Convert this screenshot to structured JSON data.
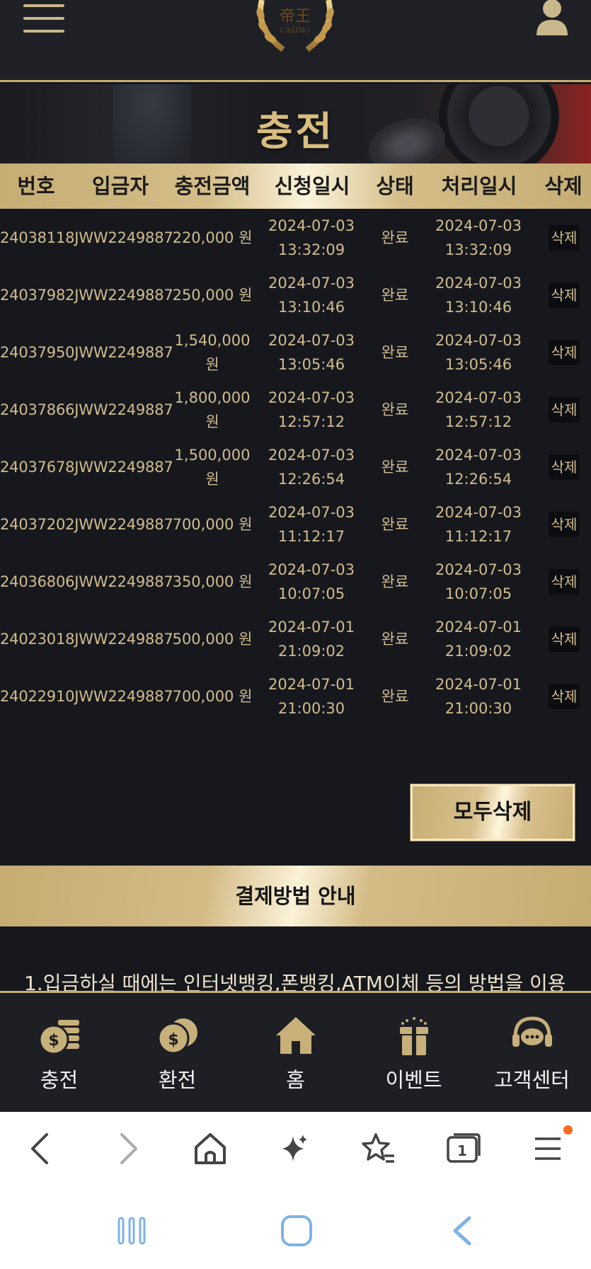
{
  "header": {
    "menu_icon": "hamburger-icon",
    "logo_text": "CASINO",
    "logo_chars": "帝王",
    "user_icon": "user-icon"
  },
  "banner": {
    "title": "충전"
  },
  "table": {
    "columns": [
      "번호",
      "입금자",
      "충전금액",
      "신청일시",
      "상태",
      "처리일시",
      "삭제"
    ],
    "rows": [
      {
        "id": "24038118JWW2249887",
        "amount": "220,000 원",
        "requested": "2024-07-03 13:32:09",
        "status": "완료",
        "processed": "2024-07-03 13:32:09",
        "delete": "삭제"
      },
      {
        "id": "24037982JWW2249887",
        "amount": "250,000 원",
        "requested": "2024-07-03 13:10:46",
        "status": "완료",
        "processed": "2024-07-03 13:10:46",
        "delete": "삭제"
      },
      {
        "id": "24037950JWW2249887",
        "amount": "1,540,000 원",
        "requested": "2024-07-03 13:05:46",
        "status": "완료",
        "processed": "2024-07-03 13:05:46",
        "delete": "삭제"
      },
      {
        "id": "24037866JWW2249887",
        "amount": "1,800,000 원",
        "requested": "2024-07-03 12:57:12",
        "status": "완료",
        "processed": "2024-07-03 12:57:12",
        "delete": "삭제"
      },
      {
        "id": "24037678JWW2249887",
        "amount": "1,500,000 원",
        "requested": "2024-07-03 12:26:54",
        "status": "완료",
        "processed": "2024-07-03 12:26:54",
        "delete": "삭제"
      },
      {
        "id": "24037202JWW2249887",
        "amount": "700,000 원",
        "requested": "2024-07-03 11:12:17",
        "status": "완료",
        "processed": "2024-07-03 11:12:17",
        "delete": "삭제"
      },
      {
        "id": "24036806JWW2249887",
        "amount": "350,000 원",
        "requested": "2024-07-03 10:07:05",
        "status": "완료",
        "processed": "2024-07-03 10:07:05",
        "delete": "삭제"
      },
      {
        "id": "24023018JWW2249887",
        "amount": "500,000 원",
        "requested": "2024-07-01 21:09:02",
        "status": "완료",
        "processed": "2024-07-01 21:09:02",
        "delete": "삭제"
      },
      {
        "id": "24022910JWW2249887",
        "amount": "700,000 원",
        "requested": "2024-07-01 21:00:30",
        "status": "완료",
        "processed": "2024-07-01 21:00:30",
        "delete": "삭제"
      }
    ]
  },
  "actions": {
    "delete_all": "모두삭제"
  },
  "guide": {
    "title": "결제방법 안내",
    "text": "1.입금하실 때에는 인터넷뱅킹,폰뱅킹,ATM이체 등의 방법을 이용"
  },
  "bottom_nav": [
    {
      "label": "충전",
      "icon": "coins-stack-icon"
    },
    {
      "label": "환전",
      "icon": "coins-icon"
    },
    {
      "label": "홈",
      "icon": "home-icon"
    },
    {
      "label": "이벤트",
      "icon": "gift-icon"
    },
    {
      "label": "고객센터",
      "icon": "headset-icon"
    }
  ],
  "browser_bar": [
    "back-icon",
    "forward-icon",
    "home-icon",
    "sparkle-icon",
    "bookmarks-icon",
    "tabs-icon",
    "menu-icon"
  ],
  "browser_tabs_count": "1",
  "system_nav": [
    "recents-icon",
    "home-icon",
    "back-icon"
  ],
  "colors": {
    "gold": "#c8ad75",
    "dark": "#16181d",
    "text_gold": "#d2bc8f",
    "badge": "#f36a21"
  }
}
